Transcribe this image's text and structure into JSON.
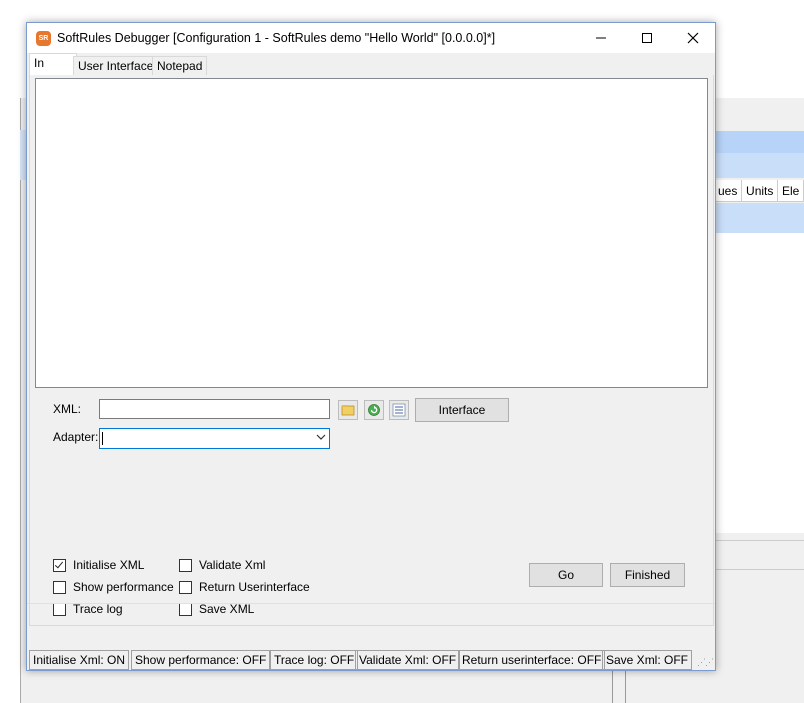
{
  "window": {
    "title": "SoftRules Debugger [Configuration 1 - SoftRules demo \"Hello World\" [0.0.0.0]*]",
    "app_icon_text": "SR",
    "controls": {
      "minimize": "—",
      "maximize": "☐",
      "close": "✕"
    }
  },
  "tabs": [
    {
      "label": "In",
      "active": true
    },
    {
      "label": "User Interface",
      "active": false
    },
    {
      "label": "Notepad",
      "active": false
    }
  ],
  "form": {
    "xml_label": "XML:",
    "xml_value": "",
    "adapter_label": "Adapter:",
    "adapter_value": "",
    "interface_button": "Interface"
  },
  "options": [
    {
      "label": "Initialise XML",
      "checked": true
    },
    {
      "label": "Validate Xml",
      "checked": false
    },
    {
      "label": "Show performance",
      "checked": false
    },
    {
      "label": "Return Userinterface",
      "checked": false
    },
    {
      "label": "Trace log",
      "checked": false
    },
    {
      "label": "Save XML",
      "checked": false
    }
  ],
  "buttons": {
    "go": "Go",
    "finished": "Finished"
  },
  "statusbar": [
    "Initialise Xml: ON",
    "Show performance: OFF",
    "Trace log: OFF",
    "Validate Xml: OFF",
    "Return userinterface: OFF",
    "Save Xml: OFF"
  ],
  "background_window": {
    "columns": [
      "ues",
      "Units",
      "Ele"
    ]
  }
}
